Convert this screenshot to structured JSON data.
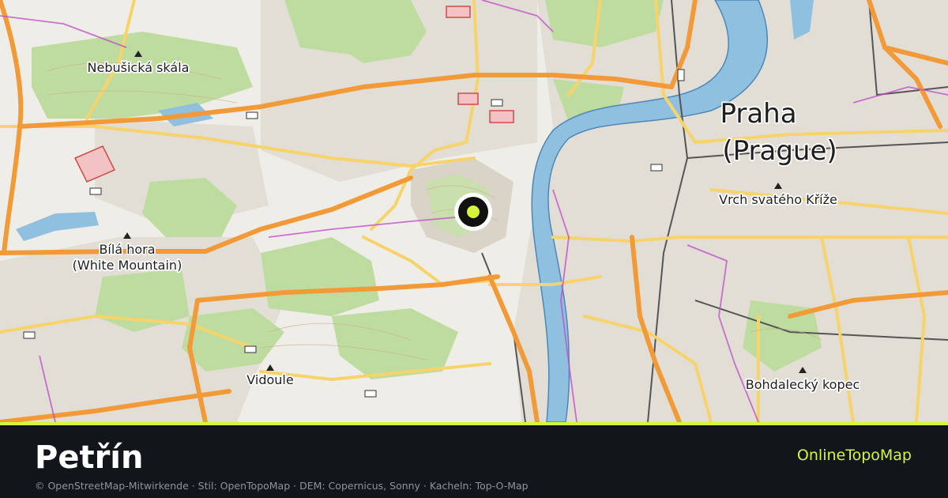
{
  "page": {
    "title": "Petřín",
    "brand": "OnlineTopoMap",
    "attribution": "© OpenStreetMap-Mitwirkende · Stil: OpenTopoMap · DEM: Copernicus, Sonny · Kacheln: Top-O-Map"
  },
  "colors": {
    "accent": "#d4f53a",
    "footer_bg": "#12161b",
    "water": "#8fc0e0",
    "forest": "#a9d08e",
    "road_major": "#f29a38",
    "road_secondary": "#f6d36b",
    "marker": "#d4f53a"
  },
  "map": {
    "labels": {
      "nebusicka": "Nebušická skála",
      "praha": "Praha",
      "prague": "(Prague)",
      "vrch": "Vrch svatého Kříže",
      "bila": "Bílá hora",
      "white": "(White Mountain)",
      "vidoule": "Vidoule",
      "bohdalecky": "Bohdalecký kopec"
    },
    "marker_icon": "location-dot-icon",
    "peak_icon": "peak-triangle-icon"
  }
}
